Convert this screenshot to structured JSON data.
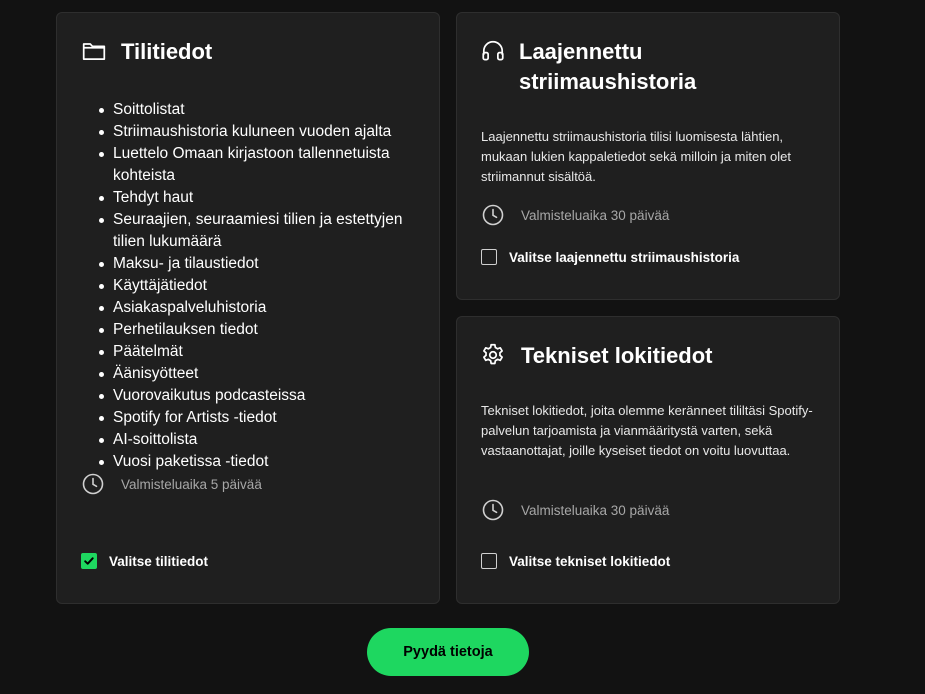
{
  "account": {
    "title": "Tilitiedot",
    "items": [
      "Soittolistat",
      "Striimaushistoria kuluneen vuoden ajalta",
      "Luettelo Omaan kirjastoon tallennetuista kohteista",
      "Tehdyt haut",
      "Seuraajien, seuraamiesi tilien ja estettyjen tilien lukumäärä",
      "Maksu- ja tilaustiedot",
      "Käyttäjätiedot",
      "Asiakaspalveluhistoria",
      "Perhetilauksen tiedot",
      "Päätelmät",
      "Äänisyötteet",
      "Vuorovaikutus podcasteissa",
      "Spotify for Artists -tiedot",
      "AI-soittolista",
      "Vuosi paketissa -tiedot"
    ],
    "prep_time": "Valmisteluaika 5 päivää",
    "checkbox_label": "Valitse tilitiedot",
    "checked": true
  },
  "extended": {
    "title_line1": "Laajennettu",
    "title_line2": "striimaushistoria",
    "description": "Laajennettu striimaushistoria tilisi luomisesta lähtien, mukaan lukien kappaletiedot sekä milloin ja miten olet striimannut sisältöä.",
    "prep_time": "Valmisteluaika 30 päivää",
    "checkbox_label": "Valitse laajennettu striimaushistoria",
    "checked": false
  },
  "technical": {
    "title": "Tekniset lokitiedot",
    "description": "Tekniset lokitiedot, joita olemme keränneet tililtäsi Spotify-palvelun tarjoamista ja vianmääritystä varten, sekä vastaanottajat, joille kyseiset tiedot on voitu luovuttaa.",
    "prep_time": "Valmisteluaika 30 päivää",
    "checkbox_label": "Valitse tekniset lokitiedot",
    "checked": false
  },
  "request_button_label": "Pyydä tietoja",
  "icons": {
    "account": "folder-icon",
    "extended": "headphones-icon",
    "technical": "gear-icon",
    "prep": "clock-icon",
    "check": "checkmark-icon"
  },
  "colors": {
    "accent": "#1ed760",
    "background": "#121212",
    "card": "#1f1f1f",
    "muted_text": "#a7a7a7"
  }
}
